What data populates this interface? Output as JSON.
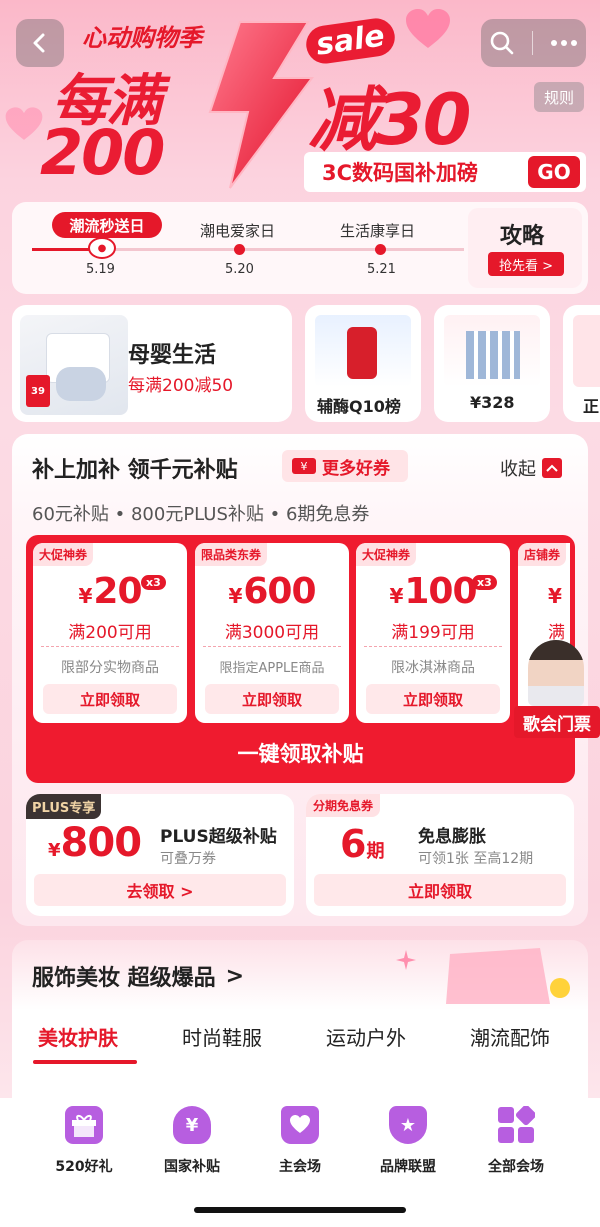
{
  "header": {
    "campaign_label": "心动购物季",
    "headline_left_1": "每满",
    "headline_left_2": "200",
    "sale_tag": "sale",
    "headline_right": "减30",
    "rules_label": "规则",
    "sub_banner": "3C数码国补加磅",
    "go_label": "GO"
  },
  "days": {
    "items": [
      {
        "label": "潮流秒送日",
        "date": "5.19"
      },
      {
        "label": "潮电爱家日",
        "date": "5.20"
      },
      {
        "label": "生活康享日",
        "date": "5.21"
      }
    ],
    "strategy_title": "攻略",
    "strategy_button": "抢先看 >"
  },
  "promo_row": {
    "main_title": "母婴生活",
    "main_subtitle": "每满200减50",
    "thumb_badge": "39",
    "items": [
      {
        "label": "辅酶Q10榜"
      },
      {
        "label": "¥328"
      },
      {
        "label": "正"
      }
    ]
  },
  "subsidy": {
    "title": "补上加补 领千元补贴",
    "more_coupons": "更多好券",
    "collapse": "收起",
    "summary": "60元补贴 • 800元PLUS补贴 • 6期免息券",
    "coupons": [
      {
        "tag": "大促神券",
        "currency": "¥",
        "amount": "20",
        "multiplier": "x3",
        "condition": "满200可用",
        "limit": "限部分实物商品",
        "action": "立即领取"
      },
      {
        "tag": "限品类东券",
        "currency": "¥",
        "amount": "600",
        "multiplier": "",
        "condition": "满3000可用",
        "limit": "限指定APPLE商品",
        "action": "立即领取"
      },
      {
        "tag": "大促神券",
        "currency": "¥",
        "amount": "100",
        "multiplier": "x3",
        "condition": "满199可用",
        "limit": "限冰淇淋商品",
        "action": "立即领取"
      },
      {
        "tag": "店铺券",
        "currency": "¥",
        "amount": "",
        "multiplier": "",
        "condition": "满",
        "limit": "",
        "action": ""
      }
    ],
    "concert_label": "歌会门票",
    "claim_all": "一键领取补贴",
    "plus": {
      "badge": "PLUS专享",
      "currency": "¥",
      "amount": "800",
      "title": "PLUS超级补贴",
      "subtitle": "可叠万券",
      "action": "去领取 >"
    },
    "installment": {
      "badge": "分期免息券",
      "amount": "6",
      "unit": "期",
      "title": "免息膨胀",
      "subtitle": "可领1张 至高12期",
      "action": "立即领取"
    }
  },
  "fashion": {
    "title": "服饰美妆 超级爆品",
    "arrow": ">",
    "tabs": [
      {
        "label": "美妆护肤"
      },
      {
        "label": "时尚鞋服"
      },
      {
        "label": "运动户外"
      },
      {
        "label": "潮流配饰"
      }
    ]
  },
  "bottom_nav": {
    "items": [
      {
        "label": "520好礼",
        "icon": "gift-icon"
      },
      {
        "label": "国家补贴",
        "icon": "money-bag-icon"
      },
      {
        "label": "主会场",
        "icon": "shopping-bag-icon"
      },
      {
        "label": "品牌联盟",
        "icon": "trophy-icon"
      },
      {
        "label": "全部会场",
        "icon": "grid-icon"
      }
    ]
  },
  "colors": {
    "brand_red": "#e5182a",
    "bg_pink": "#fbd9e3",
    "nav_purple": "#b75ee0"
  }
}
